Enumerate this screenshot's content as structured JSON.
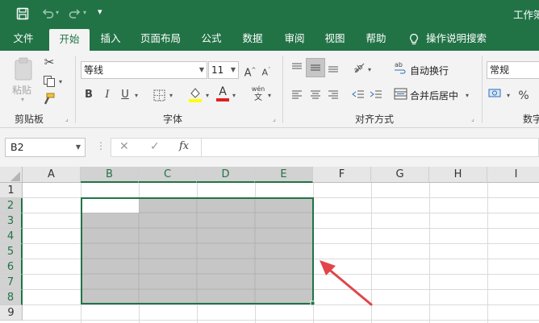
{
  "title_bar": {
    "title": "工作簿",
    "save_icon": "save-icon",
    "undo_icon": "undo-icon",
    "redo_icon": "redo-icon",
    "customize_icon": "customize-quick-access-icon"
  },
  "tabs": [
    "文件",
    "开始",
    "插入",
    "页面布局",
    "公式",
    "数据",
    "审阅",
    "视图",
    "帮助"
  ],
  "tell_me": "操作说明搜索",
  "ribbon": {
    "clipboard": {
      "paste": "粘贴",
      "label": "剪贴板"
    },
    "font": {
      "family": "等线",
      "size": "11",
      "bold": "B",
      "italic": "I",
      "underline": "U",
      "label": "字体",
      "phonetic_top": "wén",
      "phonetic_bottom": "文",
      "font_color_glyph": "A"
    },
    "alignment": {
      "wrap": "自动换行",
      "merge": "合并后居中",
      "label": "对齐方式"
    },
    "number": {
      "format": "常规",
      "percent": "%",
      "label": "数字"
    }
  },
  "formula_bar": {
    "name_box": "B2",
    "cancel": "✕",
    "enter": "✓",
    "fx": "fx",
    "value": ""
  },
  "sheet": {
    "columns": [
      "A",
      "B",
      "C",
      "D",
      "E",
      "F",
      "G",
      "H",
      "I"
    ],
    "rows": [
      "1",
      "2",
      "3",
      "4",
      "5",
      "6",
      "7",
      "8",
      "9"
    ],
    "selection": "B2:E8",
    "active_cell": "B2"
  },
  "colors": {
    "accent": "#217346",
    "selection_fill": "#c6c6c6",
    "arrow": "#e0464a"
  }
}
